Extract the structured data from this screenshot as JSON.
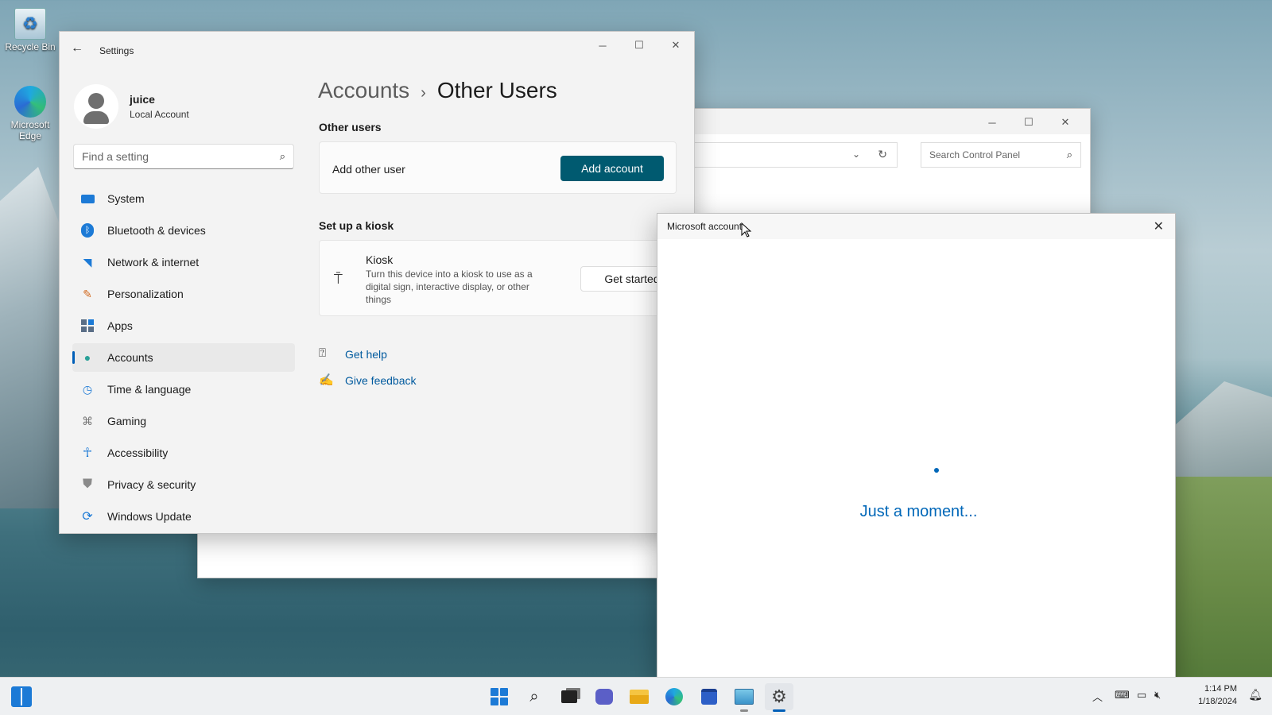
{
  "desktop": {
    "icons": [
      {
        "label": "Recycle Bin",
        "icon": "recycle-bin-icon"
      },
      {
        "label": "Microsoft Edge",
        "icon": "edge-icon"
      }
    ]
  },
  "control_panel": {
    "search_placeholder": "Search Control Panel"
  },
  "settings": {
    "app_name": "Settings",
    "profile": {
      "name": "juice",
      "account_type": "Local Account"
    },
    "search_placeholder": "Find a setting",
    "nav": [
      {
        "label": "System",
        "icon": "system-icon",
        "active": false
      },
      {
        "label": "Bluetooth & devices",
        "icon": "bluetooth-icon",
        "active": false
      },
      {
        "label": "Network & internet",
        "icon": "wifi-icon",
        "active": false
      },
      {
        "label": "Personalization",
        "icon": "brush-icon",
        "active": false
      },
      {
        "label": "Apps",
        "icon": "apps-icon",
        "active": false
      },
      {
        "label": "Accounts",
        "icon": "accounts-icon",
        "active": true
      },
      {
        "label": "Time & language",
        "icon": "clock-globe-icon",
        "active": false
      },
      {
        "label": "Gaming",
        "icon": "gamepad-icon",
        "active": false
      },
      {
        "label": "Accessibility",
        "icon": "accessibility-icon",
        "active": false
      },
      {
        "label": "Privacy & security",
        "icon": "shield-icon",
        "active": false
      },
      {
        "label": "Windows Update",
        "icon": "update-icon",
        "active": false
      }
    ],
    "breadcrumb": {
      "parent": "Accounts",
      "separator": "›",
      "current": "Other Users"
    },
    "other_users": {
      "section_title": "Other users",
      "row_label": "Add other user",
      "button_label": "Add account"
    },
    "kiosk": {
      "section_title": "Set up a kiosk",
      "title": "Kiosk",
      "description": "Turn this device into a kiosk to use as a digital sign, interactive display, or other things",
      "button_label": "Get started"
    },
    "links": [
      {
        "label": "Get help",
        "icon": "help-icon"
      },
      {
        "label": "Give feedback",
        "icon": "feedback-icon"
      }
    ]
  },
  "msa_dialog": {
    "title": "Microsoft account",
    "status": "Just a moment..."
  },
  "taskbar": {
    "time": "1:14 PM",
    "date": "1/18/2024",
    "accent": "#005fb8"
  }
}
